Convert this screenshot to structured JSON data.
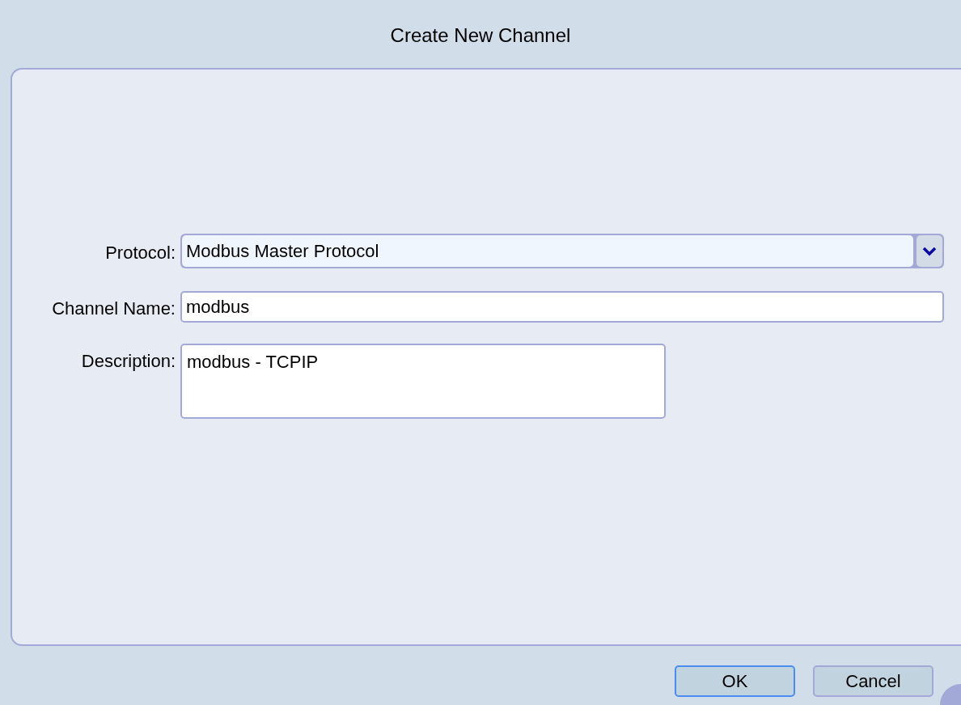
{
  "window": {
    "title": "Create New Channel"
  },
  "fields": [
    {
      "kind": "dropdown",
      "label": "Protocol:",
      "value": "Modbus Master Protocol"
    },
    {
      "kind": "text",
      "label": "Channel Name:",
      "value": "modbus"
    },
    {
      "kind": "textarea",
      "label": "Description:",
      "value": "modbus - TCPIP"
    }
  ],
  "buttons": [
    {
      "label": "OK",
      "focused": true
    },
    {
      "label": "Cancel",
      "focused": false
    }
  ]
}
